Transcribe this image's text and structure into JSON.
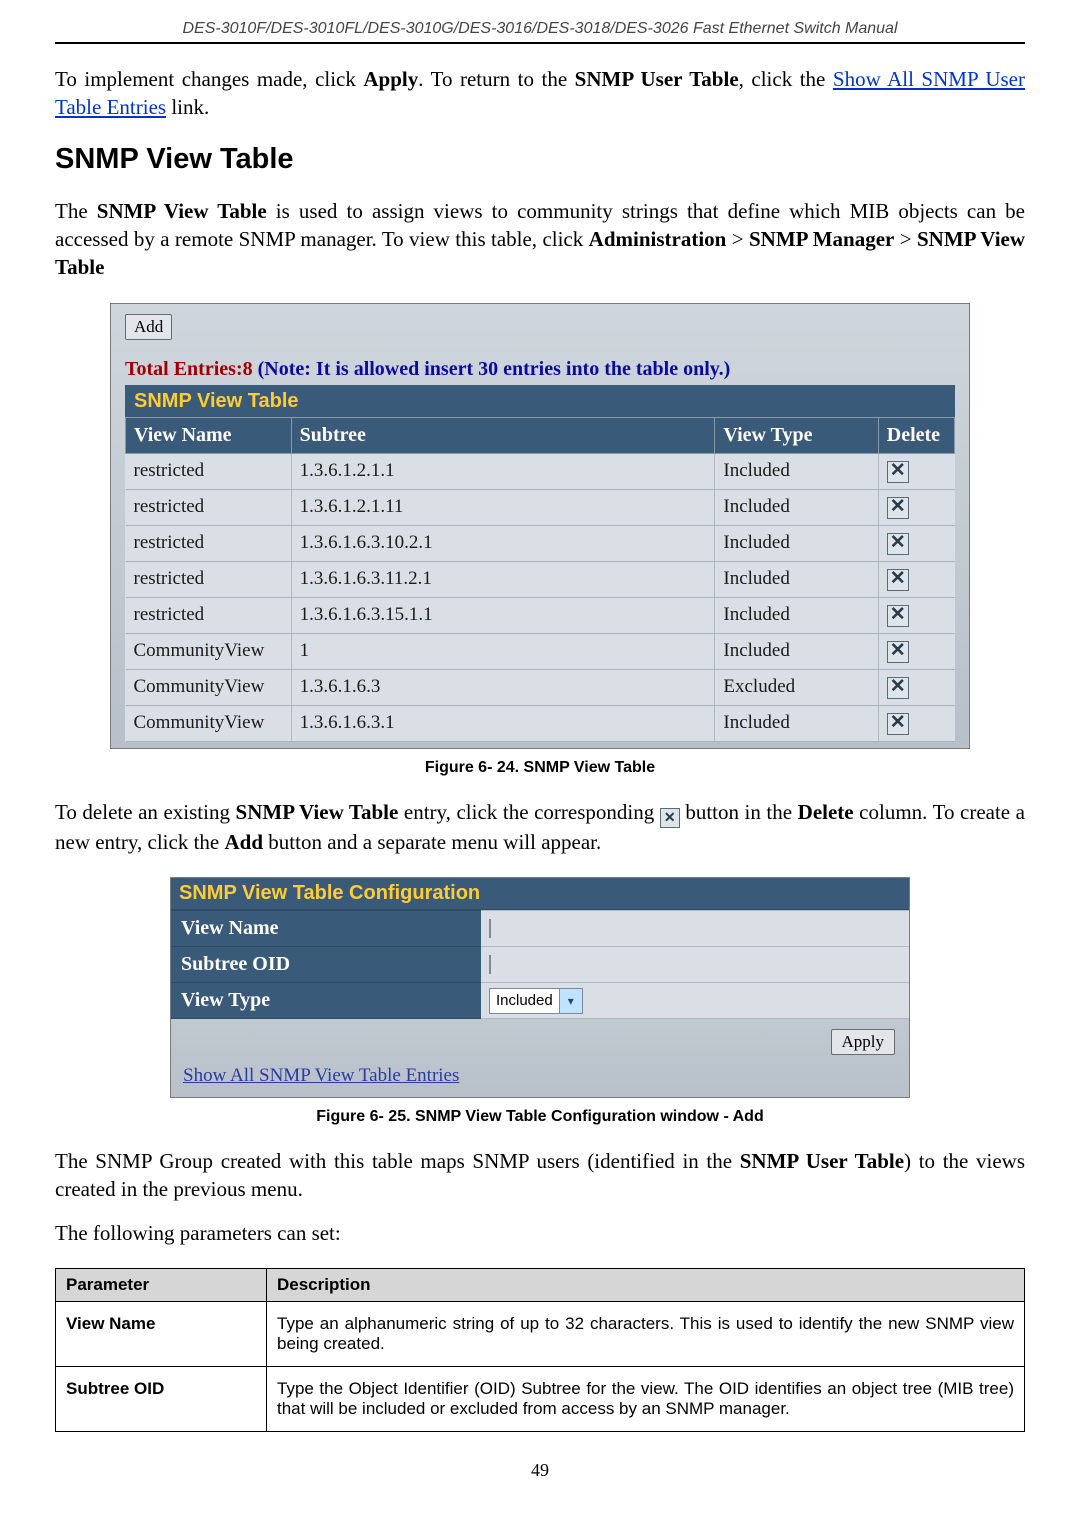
{
  "header": "DES-3010F/DES-3010FL/DES-3010G/DES-3016/DES-3018/DES-3026 Fast Ethernet Switch Manual",
  "intro": {
    "pre": "To implement changes made, click ",
    "apply": "Apply",
    "mid": ". To return to the ",
    "table": "SNMP User Table",
    "post": ", click the ",
    "link": "Show All SNMP User Table Entries",
    "linkpost": " link."
  },
  "section_title": "SNMP View Table",
  "section_body": {
    "p1_a": "The ",
    "p1_b": "SNMP View Table",
    "p1_c": " is used to assign views to community strings that define which MIB objects can be accessed by a remote SNMP manager. To view this table, click ",
    "p1_d": "Administration",
    "p1_e": " > ",
    "p1_f": "SNMP Manager",
    "p1_g": " > ",
    "p1_h": "SNMP View Table"
  },
  "fig1": {
    "add_label": "Add",
    "total_label": "Total Entries:8 ",
    "total_note": "(Note: It is allowed insert 30 entries into the table only.)",
    "title": "SNMP View Table",
    "headers": {
      "vname": "View Name",
      "subtree": "Subtree",
      "vtype": "View Type",
      "del": "Delete"
    },
    "rows": [
      {
        "vname": "restricted",
        "subtree": "1.3.6.1.2.1.1",
        "vtype": "Included"
      },
      {
        "vname": "restricted",
        "subtree": "1.3.6.1.2.1.11",
        "vtype": "Included"
      },
      {
        "vname": "restricted",
        "subtree": "1.3.6.1.6.3.10.2.1",
        "vtype": "Included"
      },
      {
        "vname": "restricted",
        "subtree": "1.3.6.1.6.3.11.2.1",
        "vtype": "Included"
      },
      {
        "vname": "restricted",
        "subtree": "1.3.6.1.6.3.15.1.1",
        "vtype": "Included"
      },
      {
        "vname": "CommunityView",
        "subtree": "1",
        "vtype": "Included"
      },
      {
        "vname": "CommunityView",
        "subtree": "1.3.6.1.6.3",
        "vtype": "Excluded"
      },
      {
        "vname": "CommunityView",
        "subtree": "1.3.6.1.6.3.1",
        "vtype": "Included"
      }
    ],
    "caption": "Figure 6- 24. SNMP View Table"
  },
  "mid_para": {
    "a": "To delete an existing ",
    "b": "SNMP View Table",
    "c": " entry, click the corresponding ",
    "d": " button in the ",
    "e": "Delete",
    "f": " column. To create a new entry, click the ",
    "g": "Add",
    "h": " button and a separate menu will appear."
  },
  "fig2": {
    "title": "SNMP View Table Configuration",
    "rows": {
      "vname": "View Name",
      "subtree": "Subtree OID",
      "vtype": "View Type",
      "vtype_value": "Included"
    },
    "apply": "Apply",
    "showall": "Show All SNMP View Table Entries",
    "caption": "Figure 6- 25. SNMP View Table Configuration window - Add"
  },
  "after_fig2": {
    "p1_a": "The SNMP Group created with this table maps SNMP users (identified in the ",
    "p1_b": "SNMP User Table",
    "p1_c": ") to the views created in the previous menu.",
    "p2": "The following parameters can set:"
  },
  "param_table": {
    "h1": "Parameter",
    "h2": "Description",
    "rows": [
      {
        "name": "View Name",
        "desc": "Type an alphanumeric string of up to 32 characters. This is used to identify the new SNMP view being created."
      },
      {
        "name": "Subtree OID",
        "desc": "Type the Object Identifier (OID) Subtree for the view. The OID identifies an object tree (MIB tree) that will be included or excluded from access by an SNMP manager."
      }
    ]
  },
  "page_number": "49"
}
